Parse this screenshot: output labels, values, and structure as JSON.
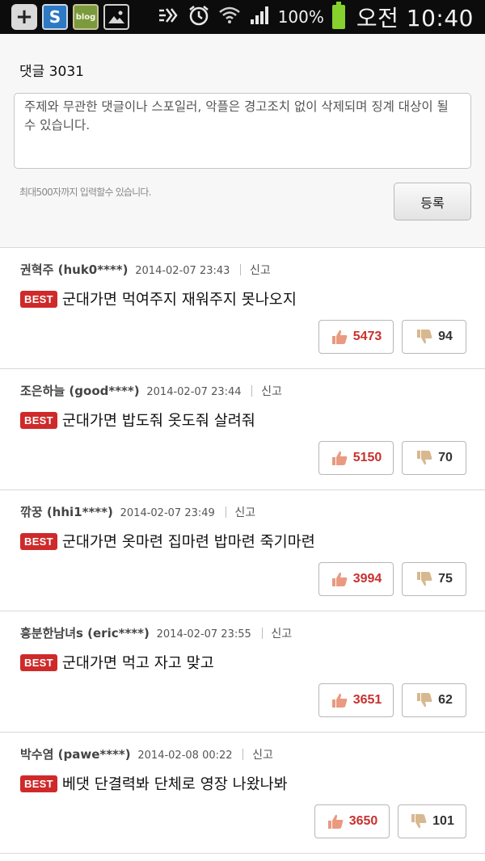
{
  "statusbar": {
    "icons": [
      "add-icon",
      "s-app-icon",
      "blog-app-icon",
      "gallery-icon",
      "mute-icon",
      "alarm-icon",
      "wifi-icon",
      "signal-icon",
      "battery-icon"
    ],
    "blog_label": "blog",
    "s_label": "S",
    "battery_percent": "100%",
    "time": "오전 10:40"
  },
  "form": {
    "count_label": "댓글 3031",
    "placeholder": "주제와 무관한 댓글이나 스포일러, 악플은 경고조치 없이 삭제되며 징계 대상이 될 수 있습니다.",
    "limit_note": "최대500자까지 입력할수 있습니다.",
    "submit_label": "등록"
  },
  "best_label": "BEST",
  "report_label": "신고",
  "colors": {
    "best_badge": "#cf2a2a",
    "upvote": "#c8312f",
    "thumb_up": "#e99a80",
    "thumb_down": "#d7b88f"
  },
  "comments": [
    {
      "author": "권혁주 (huk0****)",
      "date": "2014-02-07 23:43",
      "text": "군대가면 먹여주지 재워주지 못나오지",
      "likes": "5473",
      "dislikes": "94"
    },
    {
      "author": "조은하늘 (good****)",
      "date": "2014-02-07 23:44",
      "text": "군대가면 밥도줘 옷도줘 살려줘",
      "likes": "5150",
      "dislikes": "70"
    },
    {
      "author": "깎꿍 (hhi1****)",
      "date": "2014-02-07 23:49",
      "text": "군대가면 옷마련 집마련 밥마련 죽기마련",
      "likes": "3994",
      "dislikes": "75"
    },
    {
      "author": "흥분한남녀s (eric****)",
      "date": "2014-02-07 23:55",
      "text": "군대가면 먹고 자고 맞고",
      "likes": "3651",
      "dislikes": "62"
    },
    {
      "author": "박수염 (pawe****)",
      "date": "2014-02-08 00:22",
      "text": "베댓 단결력봐 단체로 영장 나왔나봐",
      "likes": "3650",
      "dislikes": "101"
    }
  ]
}
